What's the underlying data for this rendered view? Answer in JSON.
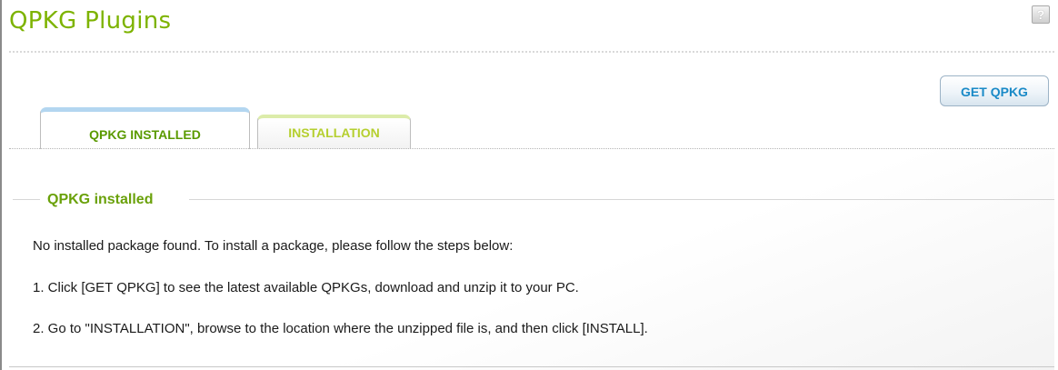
{
  "page": {
    "title": "QPKG Plugins",
    "help_icon": "question-icon"
  },
  "toolbar": {
    "get_qpkg_label": "GET QPKG"
  },
  "tabs": [
    {
      "label": "QPKG INSTALLED",
      "active": true
    },
    {
      "label": "INSTALLATION",
      "active": false
    }
  ],
  "group": {
    "title": "QPKG installed",
    "lines": [
      "No installed package found. To install a package, please follow the steps below:",
      "1. Click [GET QPKG] to see the latest available QPKGs, download and unzip it to your PC.",
      "2. Go to \"INSTALLATION\", browse to the location where the unzipped file is, and then click [INSTALL]."
    ]
  },
  "colors": {
    "title_green": "#7db300",
    "tab_active_text": "#5a9a00",
    "tab_inactive_text": "#b5cf2f",
    "button_text": "#1a8ac7"
  }
}
